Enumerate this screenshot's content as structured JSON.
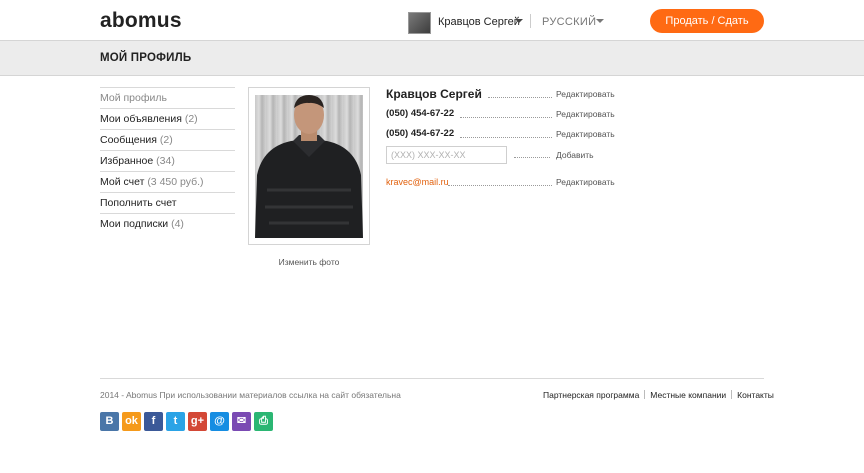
{
  "header": {
    "logo": "abomus",
    "user_name": "Кравцов Сергей",
    "language": "РУССКИЙ",
    "sell_button": "Продать / Сдать"
  },
  "page_title": "МОЙ ПРОФИЛЬ",
  "sidebar": {
    "items": [
      {
        "label": "Мой профиль",
        "count": ""
      },
      {
        "label": "Мои объявления",
        "count": "(2)"
      },
      {
        "label": "Сообщения",
        "count": "(2)"
      },
      {
        "label": "Избранное",
        "count": "(34)"
      },
      {
        "label": "Мой счет",
        "count": "(3 450 руб.)"
      },
      {
        "label": "Пополнить счет",
        "count": ""
      },
      {
        "label": "Мои подписки",
        "count": "(4)"
      }
    ]
  },
  "photo": {
    "change_label": "Изменить фото"
  },
  "profile": {
    "name": "Кравцов Сергей",
    "phone1": "(050) 454-67-22",
    "phone2": "(050) 454-67-22",
    "phone_placeholder": "(XXX) XXX-XX-XX",
    "email": "kravec@mail.ru",
    "edit_label": "Редактировать",
    "add_label": "Добавить"
  },
  "footer": {
    "copyright": "2014 - Abomus При использовании материалов ссылка на сайт обязательна",
    "links": [
      "Партнерская программа",
      "Местные компании",
      "Контакты"
    ]
  },
  "social": [
    {
      "name": "vk-icon",
      "glyph": "B",
      "color": "#4a76a8"
    },
    {
      "name": "odnoklassniki-icon",
      "glyph": "ok",
      "color": "#f59a1b"
    },
    {
      "name": "facebook-icon",
      "glyph": "f",
      "color": "#3b5998"
    },
    {
      "name": "twitter-icon",
      "glyph": "t",
      "color": "#2aa3e6"
    },
    {
      "name": "google-plus-icon",
      "glyph": "g+",
      "color": "#d34836"
    },
    {
      "name": "mail-ru-icon",
      "glyph": "@",
      "color": "#168de2"
    },
    {
      "name": "email-icon",
      "glyph": "✉",
      "color": "#7a4ab3"
    },
    {
      "name": "print-icon",
      "glyph": "⎙",
      "color": "#2bb673"
    }
  ],
  "colors": {
    "accent": "#ff6a13",
    "email_link": "#e2620f"
  }
}
